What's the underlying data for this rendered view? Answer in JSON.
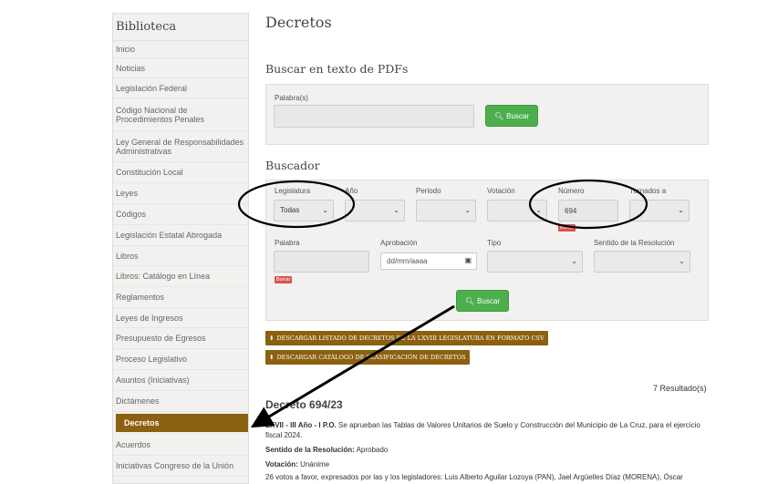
{
  "sidebar": {
    "title": "Biblioteca",
    "items": [
      {
        "label": "Inicio"
      },
      {
        "label": "Noticias"
      },
      {
        "label": "Legislación Federal"
      },
      {
        "label": "Código Nacional de Procedimientos Penales"
      },
      {
        "label": "Ley General de Responsabilidades Administrativas"
      },
      {
        "label": "Constitución Local"
      },
      {
        "label": "Leyes"
      },
      {
        "label": "Códigos"
      },
      {
        "label": "Legislación Estatal Abrogada"
      },
      {
        "label": "Libros"
      },
      {
        "label": "Libros: Catálogo en Línea"
      },
      {
        "label": "Reglamentos"
      },
      {
        "label": "Leyes de Ingresos"
      },
      {
        "label": "Presupuesto de Egresos"
      },
      {
        "label": "Proceso Legislativo"
      },
      {
        "label": "Asuntos (Iniciativas)"
      },
      {
        "label": "Dictámenes"
      },
      {
        "label": "Decretos"
      },
      {
        "label": "Acuerdos"
      },
      {
        "label": "Iniciativas Congreso de la Unión"
      }
    ],
    "active": "Decretos"
  },
  "page": {
    "title": "Decretos"
  },
  "pdf_search": {
    "title": "Buscar en texto de PDFs",
    "label": "Palabra(s)",
    "value": "",
    "button": "Buscar"
  },
  "finder": {
    "title": "Buscador",
    "legislatura": {
      "label": "Legislatura",
      "value": "Todas"
    },
    "anio": {
      "label": "Año",
      "value": ""
    },
    "periodo": {
      "label": "Periodo",
      "value": ""
    },
    "votacion": {
      "label": "Votación",
      "value": ""
    },
    "numero": {
      "label": "Número",
      "value": "694",
      "clear": "Borrar"
    },
    "turnados": {
      "label": "Turnados a",
      "value": ""
    },
    "palabra": {
      "label": "Palabra",
      "value": "",
      "clear": "Borrar"
    },
    "aprobacion": {
      "label": "Aprobación",
      "placeholder": "dd/mm/aaaa"
    },
    "tipo": {
      "label": "Tipo",
      "value": ""
    },
    "sentido": {
      "label": "Sentido de la Resolución",
      "value": ""
    },
    "button": "Buscar"
  },
  "downloads": {
    "csv": "DESCARGAR LISTADO DE DECRETOS DE LA LXVIII LEGISLATURA EN FORMATO CSV",
    "catalog": "DESCARGAR CATÁLOGO DE CLASIFICACIÓN DE DECRETOS"
  },
  "results": {
    "count": "7 Resultado(s)",
    "first": {
      "title": "Decreto 694/23",
      "heading_bold": "LXVII - III Año - I P.O.",
      "heading_text": " Se aprueban las Tablas de Valores Unitarios de Suelo y Construcción del Municipio de La Cruz, para el ejercicio fiscal 2024.",
      "sentido_label": "Sentido de la Resolución:",
      "sentido_value": " Aprobado",
      "votacion_label": "Votación:",
      "votacion_value": " Unánime",
      "votes_text": "26 votos a favor, expresados por las y los legisladores: Luis Alberto Aguilar Lozoya (PAN), Jael Argüelles Díaz (MORENA), Óscar"
    }
  },
  "colors": {
    "accent": "#8b6110",
    "button": "#4cae4c",
    "danger": "#d9534f"
  }
}
